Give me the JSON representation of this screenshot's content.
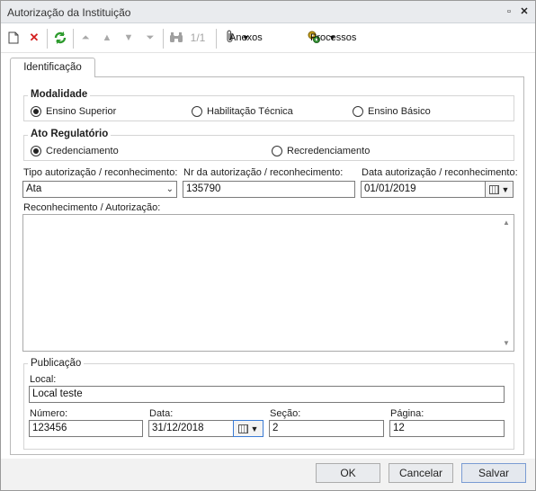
{
  "window": {
    "title": "Autorização da Instituição"
  },
  "toolbar": {
    "page_counter": "1/1",
    "anexos_label": "Anexos",
    "processos_label": "Processos"
  },
  "tabs": [
    {
      "label": "Identificação"
    }
  ],
  "modalidade": {
    "title": "Modalidade",
    "options": [
      {
        "label": "Ensino Superior",
        "selected": true
      },
      {
        "label": "Habilitação Técnica",
        "selected": false
      },
      {
        "label": "Ensino Básico",
        "selected": false
      }
    ]
  },
  "ato": {
    "title": "Ato Regulatório",
    "options": [
      {
        "label": "Credenciamento",
        "selected": true
      },
      {
        "label": "Recredenciamento",
        "selected": false
      }
    ]
  },
  "fields": {
    "tipo_label": "Tipo autorização / reconhecimento:",
    "tipo_value": "Ata",
    "nr_label": "Nr da autorização / reconhecimento:",
    "nr_value": "135790",
    "data_label": "Data autorização / reconhecimento:",
    "data_value": "01/01/2019",
    "reconhecimento_label": "Reconhecimento / Autorização:",
    "reconhecimento_value": ""
  },
  "publicacao": {
    "title": "Publicação",
    "local_label": "Local:",
    "local_value": "Local teste",
    "numero_label": "Número:",
    "numero_value": "123456",
    "data_label": "Data:",
    "data_value": "31/12/2018",
    "secao_label": "Seção:",
    "secao_value": "2",
    "pagina_label": "Página:",
    "pagina_value": "12"
  },
  "footer": {
    "ok_label": "OK",
    "cancel_label": "Cancelar",
    "save_label": "Salvar"
  }
}
